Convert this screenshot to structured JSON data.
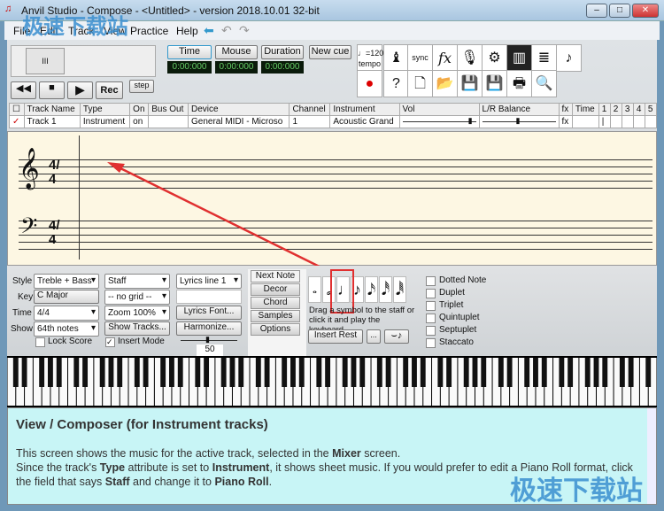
{
  "window": {
    "title": "Anvil Studio - Compose - <Untitled> - version 2018.10.01 32-bit"
  },
  "menu": [
    "File",
    "Edit",
    "Track",
    "View",
    "Practice",
    "Help"
  ],
  "toolbar": {
    "time": "Time",
    "mouse": "Mouse",
    "duration": "Duration",
    "new_cue": "New cue",
    "time_val": "0:00:000",
    "mouse_val": "0:00:000",
    "duration_val": "0:00:000",
    "rec": "Rec",
    "step": "step",
    "tempo": "♩=120 tempo",
    "sync": "sync",
    "fx": "fx"
  },
  "tracks": {
    "headers": [
      "Track Name",
      "Type",
      "On",
      "Bus Out",
      "Device",
      "Channel",
      "Instrument",
      "Vol",
      "L/R Balance",
      "fx",
      "Time",
      "1",
      "2",
      "3",
      "4",
      "5"
    ],
    "rows": [
      [
        "Track 1",
        "Instrument",
        "on",
        "",
        "General MIDI - Microso",
        "1",
        "Acoustic Grand",
        "",
        "",
        "fx",
        "",
        "",
        "",
        "",
        "",
        ""
      ]
    ]
  },
  "score": {
    "time_sig": "4/4"
  },
  "controls": {
    "style_label": "Style",
    "style": "Treble + Bass",
    "key_label": "Key",
    "key": "C Major",
    "time_label": "Time",
    "time": "4/4",
    "show_label": "Show",
    "show": "64th notes",
    "view": "Staff",
    "grid": "-- no grid --",
    "zoom": "Zoom 100%",
    "show_tracks": "Show Tracks...",
    "lock_score": "Lock Score",
    "insert_mode": "Insert Mode",
    "lyrics": "Lyrics line 1",
    "lyrics_font": "Lyrics Font...",
    "harmonize": "Harmonize...",
    "slider_value": "50",
    "tabs": [
      "Next Note",
      "Decor",
      "Chord",
      "Samples",
      "Options"
    ],
    "drag_hint": "Drag a symbol to the staff or click it and play the keyboard",
    "insert_rest": "Insert Rest",
    "more": "...",
    "checks": [
      "Dotted Note",
      "Duplet",
      "Triplet",
      "Quintuplet",
      "Septuplet",
      "Staccato"
    ]
  },
  "help": {
    "title": "View / Composer (for Instrument tracks)",
    "p1": [
      "This screen shows the music for the active track, selected in the ",
      "Mixer",
      " screen."
    ],
    "p2": [
      "Since the track's ",
      "Type",
      " attribute is set to ",
      "Instrument",
      ", it shows sheet music. If you would prefer to edit a Piano Roll format, click the field that says ",
      "Staff",
      " and change it to ",
      "Piano Roll",
      "."
    ]
  },
  "watermark": "极速下载站"
}
